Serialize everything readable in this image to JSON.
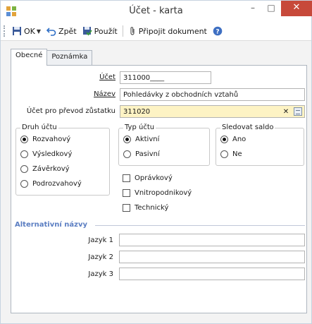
{
  "window": {
    "title": "Účet - karta",
    "minimize": "–",
    "maximize": "□",
    "close": "✕"
  },
  "toolbar": {
    "ok_label": "OK",
    "back_label": "Zpět",
    "apply_label": "Použít",
    "attach_label": "Připojit dokument"
  },
  "tabs": [
    {
      "label": "Obecné",
      "active": true
    },
    {
      "label": "Poznámka",
      "active": false
    }
  ],
  "fields": {
    "ucet": {
      "label": "Účet",
      "value": "311000____"
    },
    "nazev": {
      "label": "Název",
      "value": "Pohledávky z obchodních vztahů"
    },
    "prevod": {
      "label": "Účet pro převod zůstatku",
      "value": "311020"
    }
  },
  "druh": {
    "title": "Druh účtu",
    "options": [
      "Rozvahový",
      "Výsledkový",
      "Závěrkový",
      "Podrozvahový"
    ],
    "selected": "Rozvahový"
  },
  "typ": {
    "title": "Typ účtu",
    "options": [
      "Aktivní",
      "Pasivní"
    ],
    "selected": "Aktivní"
  },
  "saldo": {
    "title": "Sledovat saldo",
    "options": [
      "Ano",
      "Ne"
    ],
    "selected": "Ano"
  },
  "checks": [
    {
      "label": "Oprávkový",
      "checked": false
    },
    {
      "label": "Vnitropodnikový",
      "checked": false
    },
    {
      "label": "Technický",
      "checked": false
    }
  ],
  "alt": {
    "title": "Alternativní názvy",
    "labels": [
      "Jazyk 1",
      "Jazyk 2",
      "Jazyk 3"
    ],
    "values": [
      "",
      "",
      ""
    ]
  },
  "colors": {
    "close": "#c7493a",
    "highlight_field": "#fdf3c4",
    "section_head": "#5b7ec2"
  }
}
